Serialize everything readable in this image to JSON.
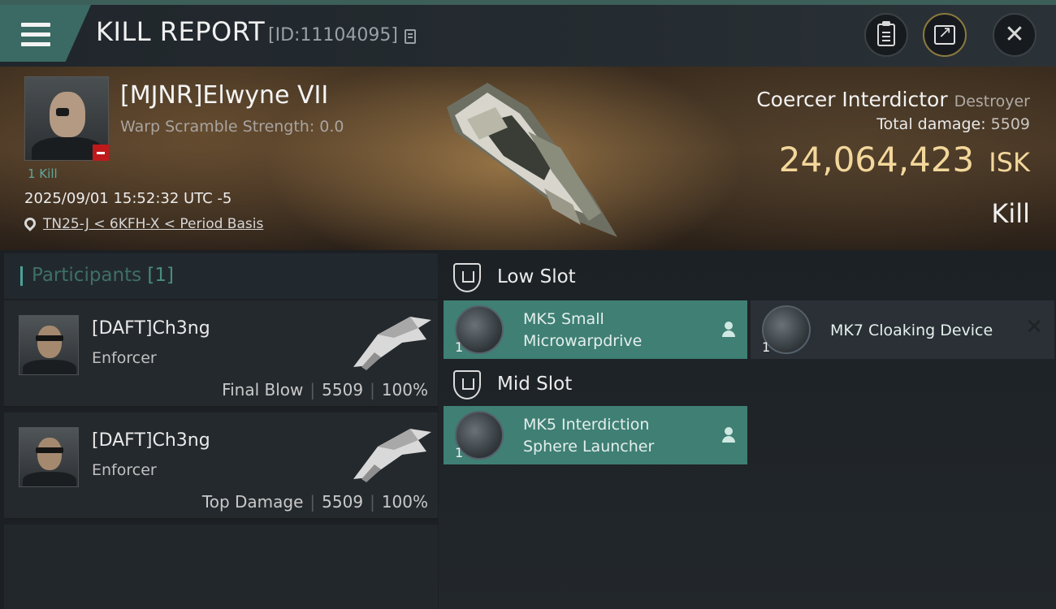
{
  "header": {
    "title": "KILL REPORT",
    "report_id": "[ID:11104095]",
    "menu_icon": "hamburger-menu-icon",
    "copy_icon": "copy-icon",
    "clipboard_icon": "clipboard-icon",
    "share_icon": "share-icon",
    "close_icon": "close-icon"
  },
  "victim": {
    "name": "[MJNR]Elwyne VII",
    "warp_scramble": "Warp Scramble Strength: 0.0",
    "kill_count": "1 Kill",
    "timestamp": "2025/09/01 15:52:32 UTC -5",
    "location": "TN25-J < 6KFH-X < Period Basis",
    "ship_name": "Coercer Interdictor",
    "ship_class": "Destroyer",
    "total_damage_label": "Total damage:",
    "total_damage": "5509",
    "isk_value": "24,064,423",
    "isk_unit": "ISK",
    "result": "Kill"
  },
  "participants": {
    "label": "Participants",
    "count": "[1]",
    "rows": [
      {
        "name": "[DAFT]Ch3ng",
        "ship": "Enforcer",
        "role": "Final Blow",
        "damage": "5509",
        "percent": "100%"
      },
      {
        "name": "[DAFT]Ch3ng",
        "ship": "Enforcer",
        "role": "Top Damage",
        "damage": "5509",
        "percent": "100%"
      }
    ]
  },
  "slots": {
    "low": {
      "title": "Low Slot",
      "modules": [
        {
          "name_line1": "MK5 Small",
          "name_line2": "Microwarpdrive",
          "qty": "1"
        },
        {
          "name": "MK7 Cloaking Device",
          "qty": "1"
        }
      ]
    },
    "mid": {
      "title": "Mid Slot",
      "modules": [
        {
          "name_line1": "MK5 Interdiction",
          "name_line2": "Sphere Launcher",
          "qty": "1"
        }
      ]
    }
  },
  "colors": {
    "accent_teal": "#3f7f74",
    "isk_gold": "#f3d79b",
    "badge_red": "#c0191c"
  }
}
